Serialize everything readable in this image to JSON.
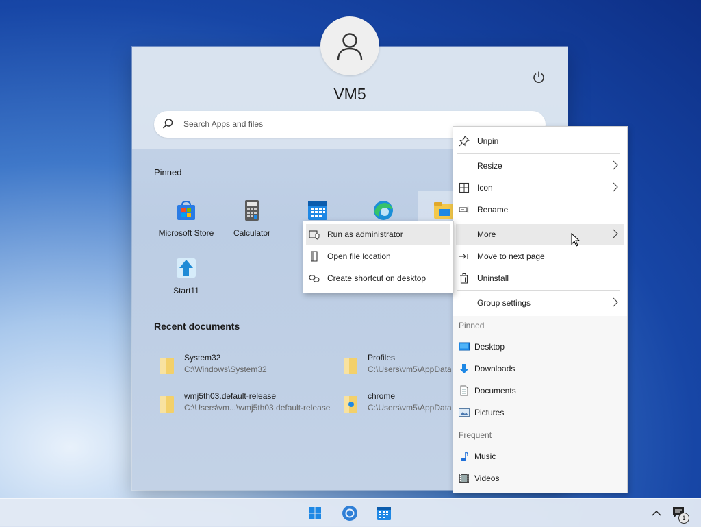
{
  "user": {
    "name": "VM5"
  },
  "search": {
    "placeholder": "Search Apps and files"
  },
  "pinned": {
    "heading": "Pinned",
    "apps": [
      {
        "label": "Microsoft Store",
        "icon": "microsoft-store-icon"
      },
      {
        "label": "Calculator",
        "icon": "calculator-icon"
      },
      {
        "label": "",
        "icon": "calendar-icon"
      },
      {
        "label": "",
        "icon": "edge-browser-icon"
      },
      {
        "label": "",
        "icon": "file-explorer-icon"
      },
      {
        "label": "Start11",
        "icon": "start11-icon"
      }
    ]
  },
  "recent": {
    "heading": "Recent documents",
    "items": [
      {
        "name": "System32",
        "path": "C:\\Windows\\System32"
      },
      {
        "name": "Profiles",
        "path": "C:\\Users\\vm5\\AppData"
      },
      {
        "name": "wmj5th03.default-release",
        "path": "C:\\Users\\vm...\\wmj5th03.default-release"
      },
      {
        "name": "chrome",
        "path": "C:\\Users\\vm5\\AppData"
      }
    ]
  },
  "context_menu": {
    "items": {
      "unpin": "Unpin",
      "resize": "Resize",
      "icon": "Icon",
      "rename": "Rename",
      "more": "More",
      "move_next": "Move to next page",
      "uninstall": "Uninstall",
      "group_settings": "Group settings"
    },
    "pinned_heading": "Pinned",
    "pinned_items": [
      "Desktop",
      "Downloads",
      "Documents",
      "Pictures"
    ],
    "frequent_heading": "Frequent",
    "frequent_items": [
      "Music",
      "Videos"
    ]
  },
  "submenu": {
    "items": [
      "Run as administrator",
      "Open file location",
      "Create shortcut on desktop"
    ]
  },
  "taskbar": {
    "notification_count": "1"
  },
  "colors": {
    "accent": "#0078d4",
    "folder_yellow": "#f3c84b"
  }
}
